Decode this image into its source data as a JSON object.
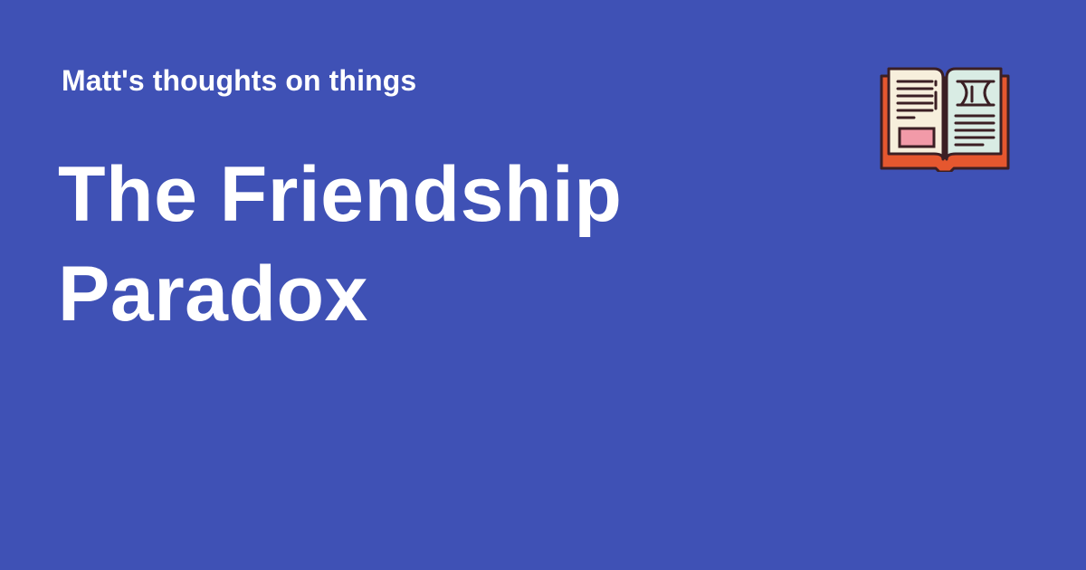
{
  "site": {
    "name": "Matt's thoughts on things"
  },
  "post": {
    "title_line1": "The Friendship",
    "title_line2": "Paradox"
  },
  "logo": {
    "icon": "open-book-icon"
  },
  "colors": {
    "background": "#3f51b5",
    "text": "#ffffff",
    "book_cover": "#e5572f",
    "book_page": "#f7efdc",
    "book_page_right": "#d9ece4",
    "book_outline": "#3b1f24",
    "book_highlight": "#f29aa8"
  }
}
